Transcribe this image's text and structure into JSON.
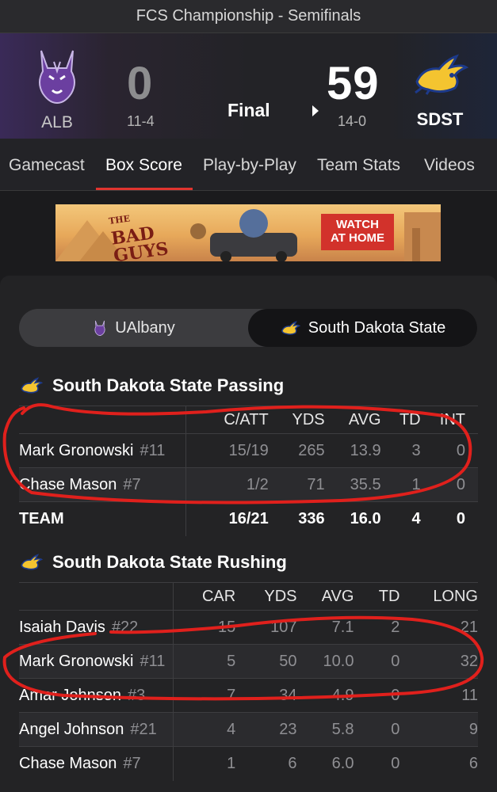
{
  "header": {
    "title": "FCS Championship - Semifinals"
  },
  "game": {
    "away": {
      "abbr": "ALB",
      "score": "0",
      "record": "11-4"
    },
    "home": {
      "abbr": "SDST",
      "score": "59",
      "record": "14-0"
    },
    "status": "Final"
  },
  "tabs": [
    "Gamecast",
    "Box Score",
    "Play-by-Play",
    "Team Stats",
    "Videos"
  ],
  "active_tab": "Box Score",
  "ad": {
    "title_line1": "THE",
    "title_line2": "BAD",
    "title_line3": "GUYS",
    "cta_line1": "WATCH",
    "cta_line2": "AT HOME"
  },
  "team_toggle": {
    "left": "UAlbany",
    "right": "South Dakota State",
    "selected": "South Dakota State"
  },
  "passing": {
    "title": "South Dakota State Passing",
    "headers": [
      "C/ATT",
      "YDS",
      "AVG",
      "TD",
      "INT"
    ],
    "rows": [
      {
        "name": "Mark Gronowski",
        "num": "#11",
        "vals": [
          "15/19",
          "265",
          "13.9",
          "3",
          "0"
        ]
      },
      {
        "name": "Chase Mason",
        "num": "#7",
        "vals": [
          "1/2",
          "71",
          "35.5",
          "1",
          "0"
        ]
      },
      {
        "name": "TEAM",
        "num": "",
        "vals": [
          "16/21",
          "336",
          "16.0",
          "4",
          "0"
        ]
      }
    ]
  },
  "rushing": {
    "title": "South Dakota State Rushing",
    "headers": [
      "CAR",
      "YDS",
      "AVG",
      "TD",
      "LONG"
    ],
    "rows": [
      {
        "name": "Isaiah Davis",
        "num": "#22",
        "vals": [
          "15",
          "107",
          "7.1",
          "2",
          "21"
        ]
      },
      {
        "name": "Mark Gronowski",
        "num": "#11",
        "vals": [
          "5",
          "50",
          "10.0",
          "0",
          "32"
        ]
      },
      {
        "name": "Amar Johnson",
        "num": "#3",
        "vals": [
          "7",
          "34",
          "4.9",
          "0",
          "11"
        ]
      },
      {
        "name": "Angel Johnson",
        "num": "#21",
        "vals": [
          "4",
          "23",
          "5.8",
          "0",
          "9"
        ]
      },
      {
        "name": "Chase Mason",
        "num": "#7",
        "vals": [
          "1",
          "6",
          "6.0",
          "0",
          "6"
        ]
      }
    ]
  },
  "colors": {
    "accent_tab": "#e0342f",
    "annotation": "#e0201c",
    "sdst_yellow": "#f4c430",
    "ualbany_purple": "#6b3fa0"
  }
}
